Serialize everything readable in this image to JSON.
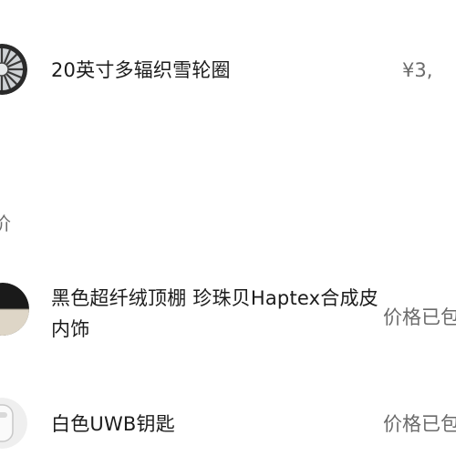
{
  "section": {
    "header_fragment": "价"
  },
  "options": [
    {
      "title": "20英寸多辐织雪轮圈",
      "price": "¥3,",
      "thumb_icon": "wheel-thumbnail"
    },
    {
      "title": "黑色超纤绒顶棚 珍珠贝Haptex合成皮内饰",
      "price": "价格已包",
      "thumb_icon": "interior-swatch-thumbnail"
    },
    {
      "title": "白色UWB钥匙",
      "price": "价格已包",
      "thumb_icon": "key-thumbnail"
    }
  ],
  "colors": {
    "price_gray": "#6b6b6b",
    "text": "#1c1c1c"
  }
}
